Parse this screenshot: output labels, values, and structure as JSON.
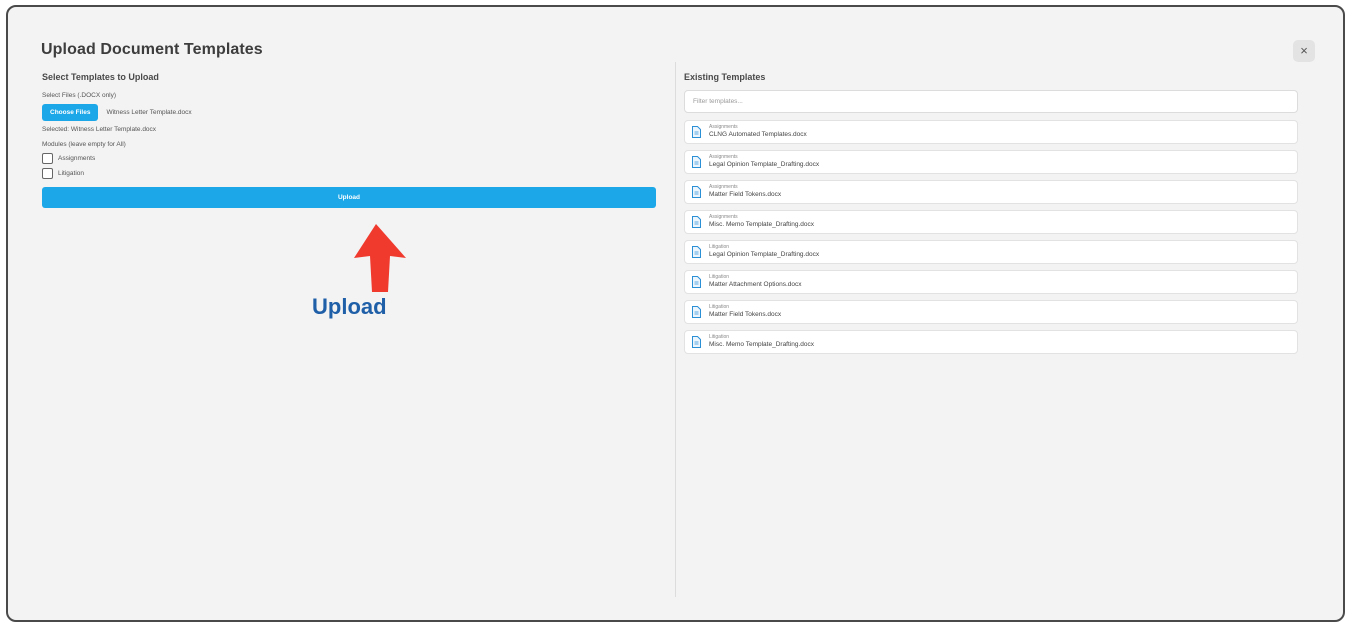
{
  "dialog": {
    "title": "Upload Document Templates",
    "close_label": "×"
  },
  "upload_section": {
    "title": "Select Templates to Upload",
    "files_label": "Select Files (.DOCX only)",
    "choose_button": "Choose Files",
    "chosen_file": "Witness Letter Template.docx",
    "selected_text": "Selected: Witness Letter Template.docx",
    "modules_label": "Modules (leave empty for All)",
    "modules": [
      {
        "label": "Assignments",
        "checked": false
      },
      {
        "label": "Litigation",
        "checked": false
      }
    ],
    "upload_button": "Upload"
  },
  "annotation": {
    "text": "Upload",
    "arrow_color": "#f03a2e",
    "text_color": "#1f5fa8"
  },
  "existing_section": {
    "title": "Existing Templates",
    "filter_placeholder": "Filter templates...",
    "templates": [
      {
        "module": "Assignments",
        "name": "CLNG Automated Templates.docx"
      },
      {
        "module": "Assignments",
        "name": "Legal Opinion Template_Drafting.docx"
      },
      {
        "module": "Assignments",
        "name": "Matter Field Tokens.docx"
      },
      {
        "module": "Assignments",
        "name": "Misc. Memo Template_Drafting.docx"
      },
      {
        "module": "Litigation",
        "name": "Legal Opinion Template_Drafting.docx"
      },
      {
        "module": "Litigation",
        "name": "Matter Attachment Options.docx"
      },
      {
        "module": "Litigation",
        "name": "Matter Field Tokens.docx"
      },
      {
        "module": "Litigation",
        "name": "Misc. Memo Template_Drafting.docx"
      }
    ]
  },
  "colors": {
    "accent": "#1ca7e8",
    "background": "#f3f3f3",
    "frame_border": "#4a4a4a"
  },
  "icons": {
    "close": "close-icon",
    "document": "document-icon",
    "annotation": "arrow-up-icon"
  }
}
